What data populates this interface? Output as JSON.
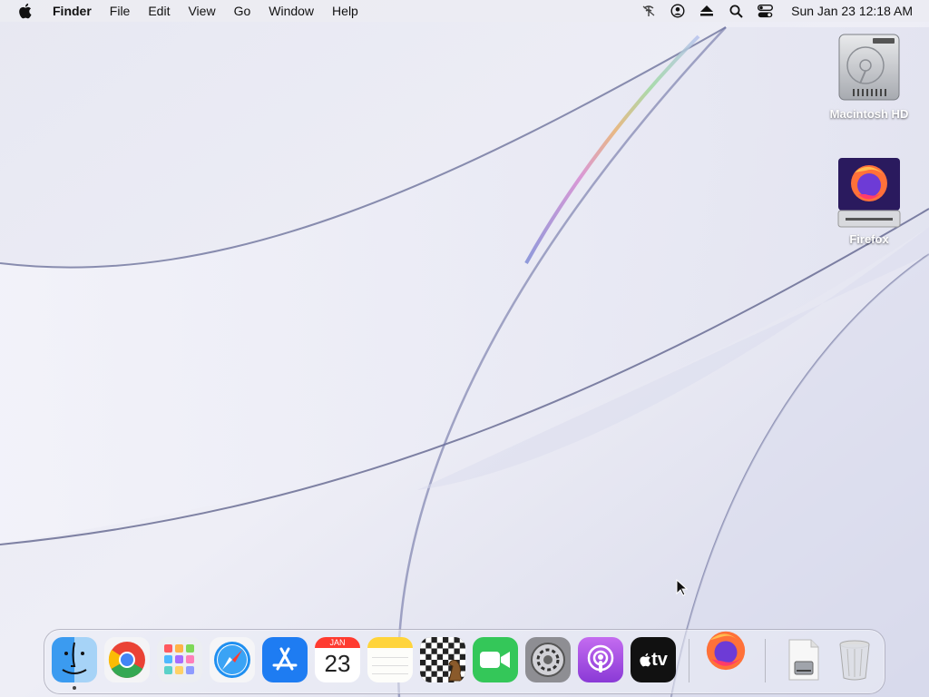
{
  "menubar": {
    "app_name": "Finder",
    "items": [
      "File",
      "Edit",
      "View",
      "Go",
      "Window",
      "Help"
    ],
    "clock": "Sun Jan 23  12:18 AM",
    "status_icons": [
      "wifi-off-icon",
      "user-icon",
      "eject-icon",
      "spotlight-icon",
      "control-center-icon"
    ]
  },
  "desktop": {
    "icons": [
      {
        "label": "Macintosh HD",
        "icon": "hard-drive-icon"
      },
      {
        "label": "Firefox",
        "icon": "firefox-disk-image-icon"
      }
    ]
  },
  "dock": {
    "apps": [
      {
        "name": "Finder",
        "icon": "finder-icon",
        "running": true
      },
      {
        "name": "Google Chrome",
        "icon": "chrome-icon"
      },
      {
        "name": "Launchpad",
        "icon": "launchpad-icon"
      },
      {
        "name": "Safari",
        "icon": "safari-icon"
      },
      {
        "name": "App Store",
        "icon": "app-store-icon"
      },
      {
        "name": "Calendar",
        "icon": "calendar-icon"
      },
      {
        "name": "Notes",
        "icon": "notes-icon"
      },
      {
        "name": "Chess",
        "icon": "chess-icon"
      },
      {
        "name": "FaceTime",
        "icon": "facetime-icon"
      },
      {
        "name": "System Preferences",
        "icon": "settings-icon"
      },
      {
        "name": "Podcasts",
        "icon": "podcasts-icon"
      },
      {
        "name": "TV",
        "icon": "apple-tv-icon"
      },
      {
        "name": "Firefox",
        "icon": "firefox-icon"
      },
      {
        "name": "Disk Image",
        "icon": "disk-image-file-icon"
      },
      {
        "name": "Trash",
        "icon": "trash-icon"
      }
    ],
    "calendar_month": "JAN",
    "calendar_day": "23",
    "tv_label": "tv"
  },
  "colors": {
    "facetime": "#34c759",
    "podcasts": "#9b4ddb",
    "appstore": "#1e7cf2",
    "chrome_red": "#ea4335",
    "chrome_green": "#34a853",
    "chrome_yellow": "#fbbc05",
    "chrome_blue": "#4285f4"
  }
}
